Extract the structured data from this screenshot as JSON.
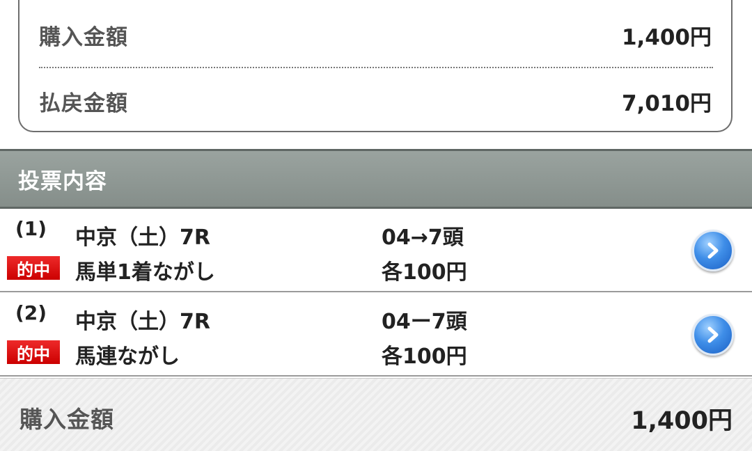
{
  "summary": {
    "purchase_label": "購入金額",
    "purchase_value": "1,400円",
    "payout_label": "払戻金額",
    "payout_value": "7,010円"
  },
  "section": {
    "title": "投票内容"
  },
  "bets": [
    {
      "number": "(1)",
      "badge": "的中",
      "race": "中京（土）7R",
      "bet_type": "馬単1着ながし",
      "combination": "04→7頭",
      "amount": "各100円",
      "detail_icon": "chevron-right-circle-icon"
    },
    {
      "number": "(2)",
      "badge": "的中",
      "race": "中京（土）7R",
      "bet_type": "馬連ながし",
      "combination": "04ー7頭",
      "amount": "各100円",
      "detail_icon": "chevron-right-circle-icon"
    }
  ],
  "footer": {
    "purchase_label": "購入金額",
    "purchase_value": "1,400円"
  },
  "colors": {
    "header_bg": "#8f9894",
    "hit_badge": "#dd1111",
    "detail_button": "#2f7ad8"
  }
}
